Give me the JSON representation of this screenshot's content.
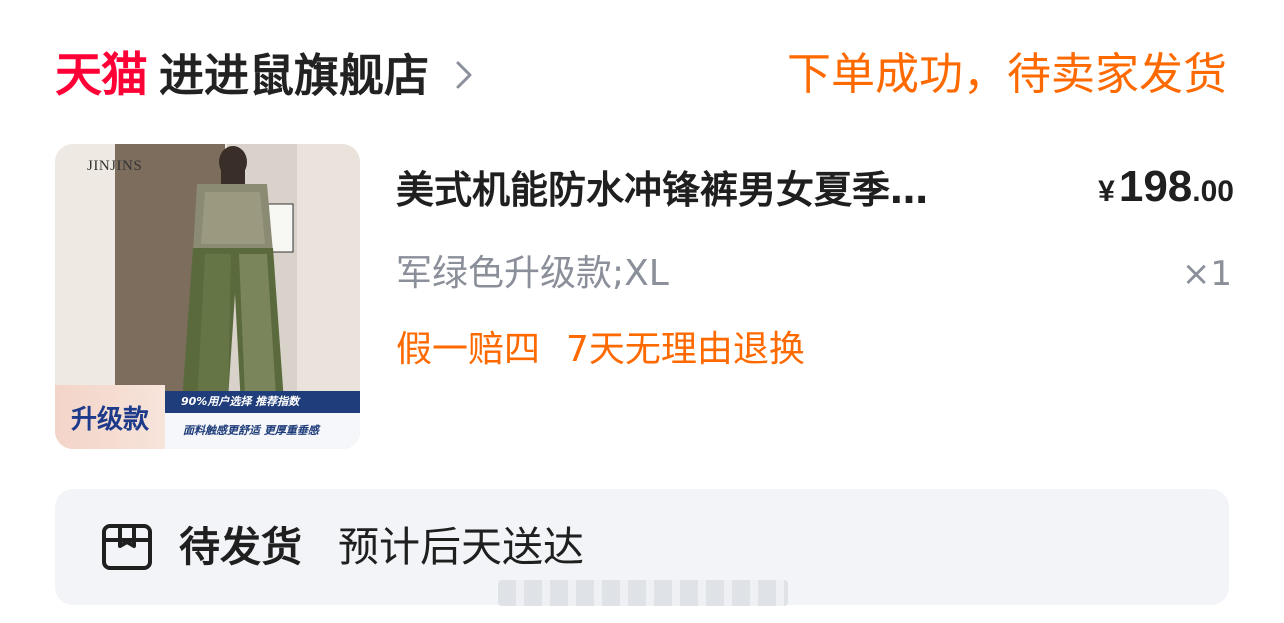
{
  "store": {
    "brand_logo": "天猫",
    "name": "进进鼠旗舰店",
    "chevron_icon": "chevron-right-icon"
  },
  "order": {
    "status": "下单成功，待卖家发货"
  },
  "product": {
    "thumbnail": {
      "brand_text": "JINJINS",
      "badge": "升级款",
      "strip": "90%用户选择 推荐指数",
      "sub": "面料触感更舒适  更厚重垂感"
    },
    "title": "美式机能防水冲锋裤男女夏季…",
    "price": {
      "symbol": "¥",
      "integer": "198",
      "decimal": ".00"
    },
    "sku": "军绿色升级款;XL",
    "quantity": "×1",
    "services": [
      "假一赔四",
      "7天无理由退换"
    ]
  },
  "delivery": {
    "icon": "package-box-icon",
    "status": "待发货",
    "eta": "预计后天送达"
  },
  "colors": {
    "tmall_red": "#ff0036",
    "accent_orange": "#ff6a00",
    "muted_gray": "#8a8f99",
    "card_bg": "#f2f4f7"
  }
}
